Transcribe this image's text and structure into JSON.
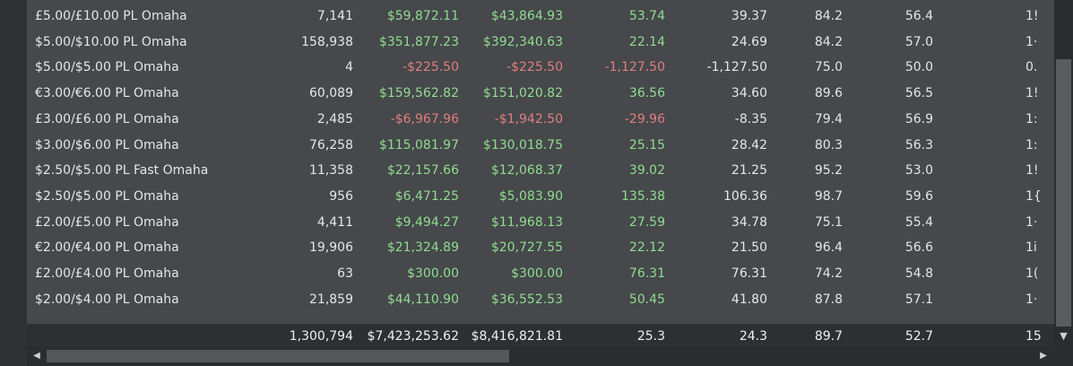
{
  "rows": [
    {
      "name": "£5.00/£10.00 PL Omaha",
      "hands": "7,141",
      "c1": "$59,872.11",
      "c2": "$43,864.93",
      "c3": "53.74",
      "c4": "39.37",
      "c5": "84.2",
      "c6": "56.4",
      "c7": "1!"
    },
    {
      "name": "$5.00/$10.00 PL Omaha",
      "hands": "158,938",
      "c1": "$351,877.23",
      "c2": "$392,340.63",
      "c3": "22.14",
      "c4": "24.69",
      "c5": "84.2",
      "c6": "57.0",
      "c7": "1·"
    },
    {
      "name": "$5.00/$5.00 PL Omaha",
      "hands": "4",
      "c1": "-$225.50",
      "c2": "-$225.50",
      "c3": "-1,127.50",
      "c4": "-1,127.50",
      "c5": "75.0",
      "c6": "50.0",
      "c7": "0."
    },
    {
      "name": "€3.00/€6.00 PL Omaha",
      "hands": "60,089",
      "c1": "$159,562.82",
      "c2": "$151,020.82",
      "c3": "36.56",
      "c4": "34.60",
      "c5": "89.6",
      "c6": "56.5",
      "c7": "1!"
    },
    {
      "name": "£3.00/£6.00 PL Omaha",
      "hands": "2,485",
      "c1": "-$6,967.96",
      "c2": "-$1,942.50",
      "c3": "-29.96",
      "c4": "-8.35",
      "c5": "79.4",
      "c6": "56.9",
      "c7": "1:"
    },
    {
      "name": "$3.00/$6.00 PL Omaha",
      "hands": "76,258",
      "c1": "$115,081.97",
      "c2": "$130,018.75",
      "c3": "25.15",
      "c4": "28.42",
      "c5": "80.3",
      "c6": "56.3",
      "c7": "1:"
    },
    {
      "name": "$2.50/$5.00 PL Fast Omaha",
      "hands": "11,358",
      "c1": "$22,157.66",
      "c2": "$12,068.37",
      "c3": "39.02",
      "c4": "21.25",
      "c5": "95.2",
      "c6": "53.0",
      "c7": "1!"
    },
    {
      "name": "$2.50/$5.00 PL Omaha",
      "hands": "956",
      "c1": "$6,471.25",
      "c2": "$5,083.90",
      "c3": "135.38",
      "c4": "106.36",
      "c5": "98.7",
      "c6": "59.6",
      "c7": "1{"
    },
    {
      "name": "£2.00/£5.00 PL Omaha",
      "hands": "4,411",
      "c1": "$9,494.27",
      "c2": "$11,968.13",
      "c3": "27.59",
      "c4": "34.78",
      "c5": "75.1",
      "c6": "55.4",
      "c7": "1·"
    },
    {
      "name": "€2.00/€4.00 PL Omaha",
      "hands": "19,906",
      "c1": "$21,324.89",
      "c2": "$20,727.55",
      "c3": "22.12",
      "c4": "21.50",
      "c5": "96.4",
      "c6": "56.6",
      "c7": "1i"
    },
    {
      "name": "£2.00/£4.00 PL Omaha",
      "hands": "63",
      "c1": "$300.00",
      "c2": "$300.00",
      "c3": "76.31",
      "c4": "76.31",
      "c5": "74.2",
      "c6": "54.8",
      "c7": "1("
    },
    {
      "name": "$2.00/$4.00 PL Omaha",
      "hands": "21,859",
      "c1": "$44,110.90",
      "c2": "$36,552.53",
      "c3": "50.45",
      "c4": "41.80",
      "c5": "87.8",
      "c6": "57.1",
      "c7": "1·"
    }
  ],
  "totals": {
    "hands": "1,300,794",
    "c1": "$7,423,253.62",
    "c2": "$8,416,821.81",
    "c3": "25.3",
    "c4": "24.3",
    "c5": "89.7",
    "c6": "52.7",
    "c7": "15"
  },
  "scroll": {
    "down_arrow": "▼",
    "left_arrow": "◀",
    "right_arrow": "▶"
  },
  "colors": {
    "positive": "#8fdc8f",
    "negative": "#e07e7e",
    "panel": "#46484b",
    "total_bg": "#2d2f32"
  }
}
